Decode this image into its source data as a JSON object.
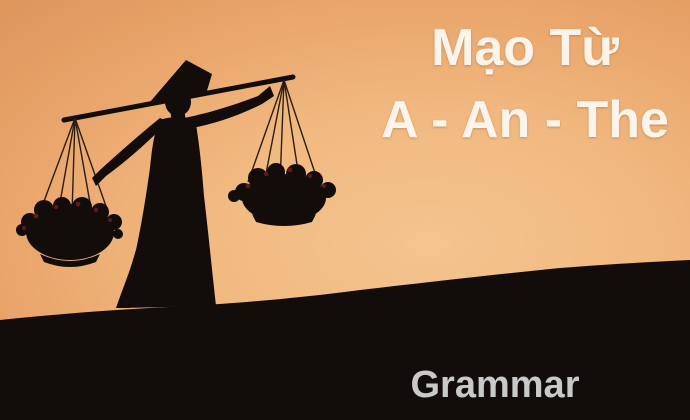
{
  "title": {
    "line1": "Mạo Từ",
    "line2": "A - An - The"
  },
  "caption": "Grammar",
  "colors": {
    "sky_center": "#f4c48f",
    "sky_edge": "#dd955c",
    "silhouette": "#120d0b",
    "title_text": "#fbf4ea",
    "caption_text": "#c9c9c9"
  },
  "scene": {
    "description_elements": [
      "conical-hat",
      "shoulder-pole",
      "hanging-flower-baskets",
      "hill-silhouette"
    ]
  }
}
